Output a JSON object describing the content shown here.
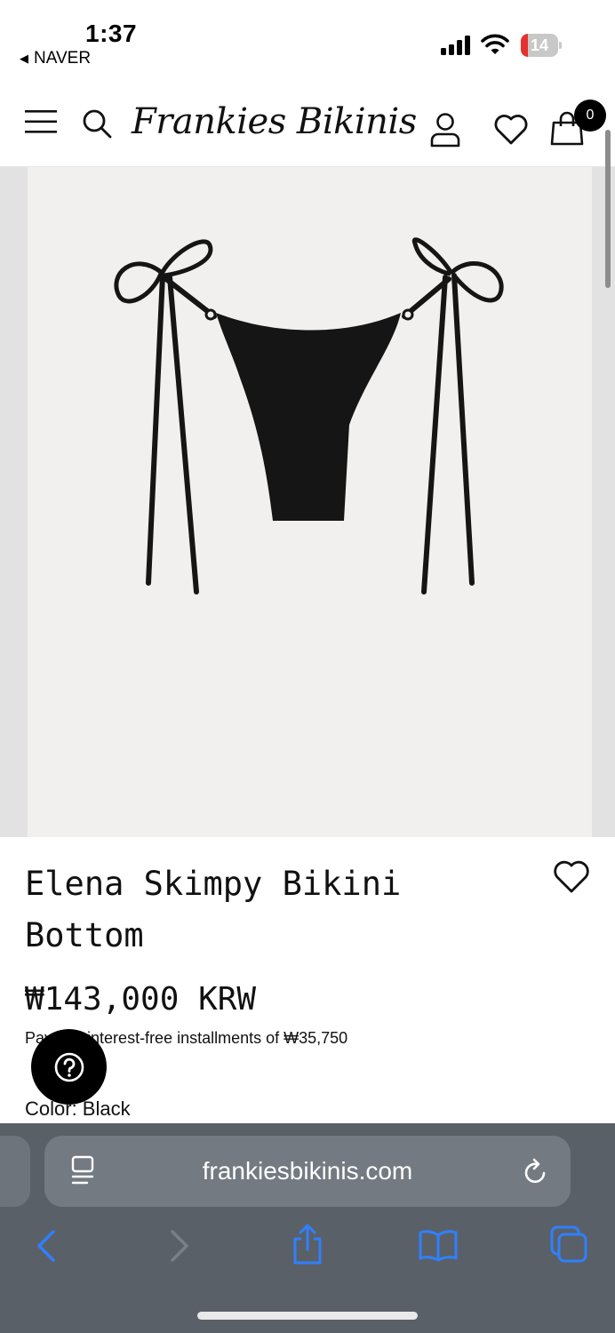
{
  "status_bar": {
    "time": "1:37",
    "back_app": "NAVER",
    "battery_level": "14",
    "battery_fraction": 0.14
  },
  "header": {
    "brand": "Frankies Bikinis",
    "cart_count": "0",
    "icons": [
      "menu-icon",
      "search-icon",
      "account-icon",
      "heart-icon",
      "bag-icon"
    ]
  },
  "product": {
    "title": "Elena Skimpy Bikini Bottom",
    "price": "₩143,000 KRW",
    "installments": "Pay in 4 interest-free installments of ₩35,750",
    "color_label": "Color: Black",
    "image_color": "#151515"
  },
  "help": {
    "icon": "question-circle-icon"
  },
  "browser": {
    "url": "frankiesbikinis.com",
    "icons": [
      "page-menu-icon",
      "reload-icon",
      "back-icon",
      "forward-icon",
      "share-icon",
      "bookmarks-icon",
      "tabs-icon"
    ]
  },
  "colors": {
    "accent_link": "#2f80ff",
    "toolbar_bg": "#5a6068",
    "image_bg": "#f1f0ee",
    "badge_bg": "#000000"
  }
}
